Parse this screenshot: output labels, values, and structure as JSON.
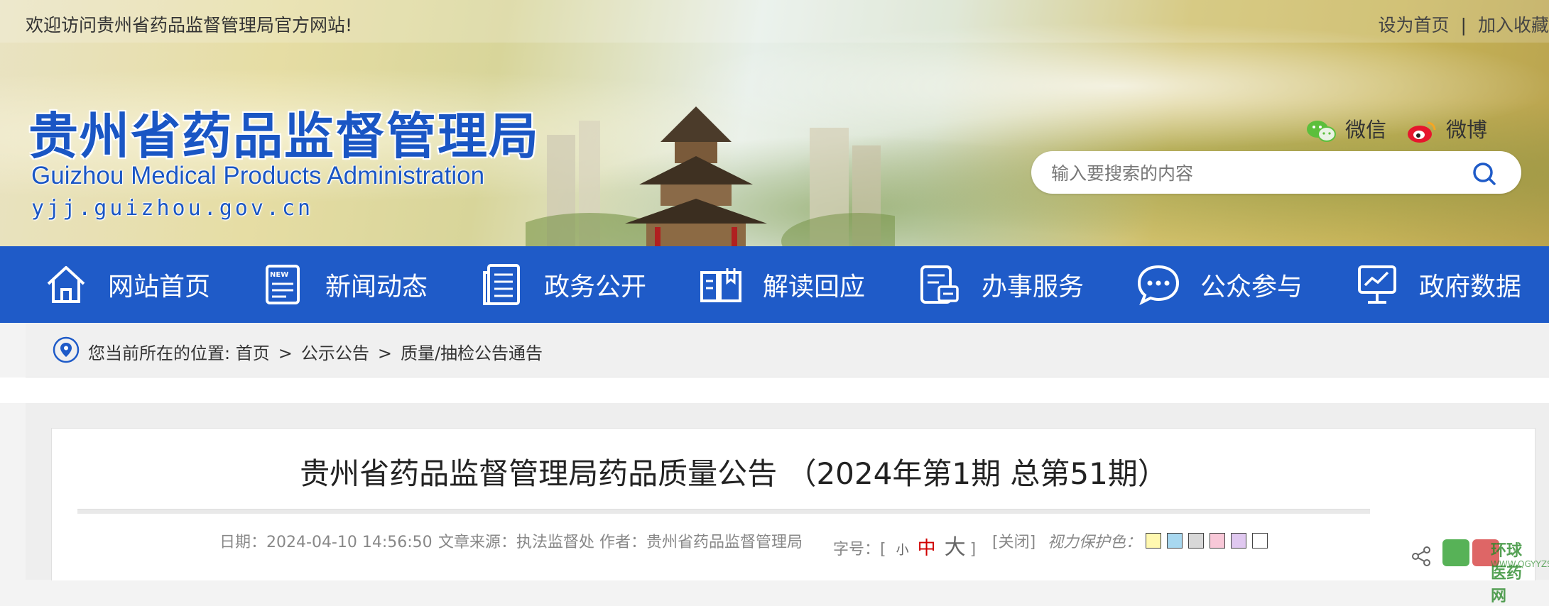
{
  "topbar": {
    "welcome": "欢迎访问贵州省药品监督管理局官方网站!",
    "set_home": "设为首页",
    "separator": "|",
    "add_favorite": "加入收藏"
  },
  "logo": {
    "name_cn": "贵州省药品监督管理局",
    "name_en": "Guizhou Medical Products Administration",
    "domain": "yjj.guizhou.gov.cn"
  },
  "social": {
    "wechat": "微信",
    "weibo": "微博"
  },
  "search": {
    "placeholder": "输入要搜索的内容"
  },
  "nav": {
    "items": [
      {
        "label": "网站首页",
        "icon": "home-icon"
      },
      {
        "label": "新闻动态",
        "icon": "news-icon"
      },
      {
        "label": "政务公开",
        "icon": "document-icon"
      },
      {
        "label": "解读回应",
        "icon": "book-icon"
      },
      {
        "label": "办事服务",
        "icon": "service-icon"
      },
      {
        "label": "公众参与",
        "icon": "chat-icon"
      },
      {
        "label": "政府数据",
        "icon": "data-icon"
      }
    ]
  },
  "breadcrumb": {
    "prefix": "您当前所在的位置:",
    "items": [
      "首页",
      "公示公告",
      "质量/抽检公告通告"
    ],
    "separator": ">"
  },
  "article": {
    "title": "贵州省药品监督管理局药品质量公告 （2024年第1期 总第51期）",
    "date_label": "日期：",
    "date": "2024-04-10 14:56:50",
    "source_label": "文章来源：",
    "source": "执法监督处",
    "author_label": "作者：",
    "author": "贵州省药品监督管理局",
    "font_label": "字号：[",
    "font_small": "小",
    "font_medium": "中",
    "font_large": "大",
    "font_close_bracket": "]",
    "close": "[关闭]",
    "eye_label": "视力保护色：",
    "eye_colors": [
      "#fff8b0",
      "#a8d8f0",
      "#d8d8d8",
      "#f8c8d8",
      "#e0c8f0",
      "#ffffff"
    ]
  },
  "watermark": {
    "text": "环球医药网",
    "sub": "WWW.QGYYZS.NET"
  },
  "colors": {
    "nav_bg": "#1f5bc8",
    "brand_blue": "#1a56c4",
    "accent_red": "#d00000"
  }
}
